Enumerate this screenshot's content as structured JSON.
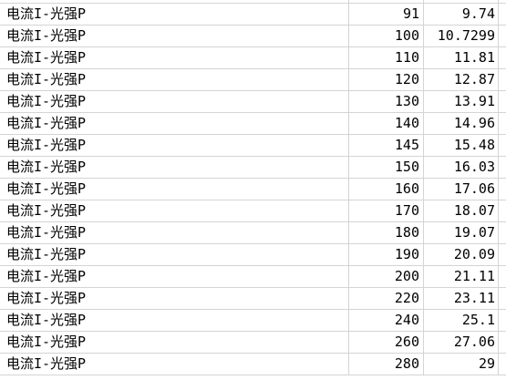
{
  "header_fragment": {
    "col_a": "……"
  },
  "rows": [
    {
      "label": "电流I-光强P",
      "p": "91",
      "i": "9.74"
    },
    {
      "label": "电流I-光强P",
      "p": "100",
      "i": "10.7299"
    },
    {
      "label": "电流I-光强P",
      "p": "110",
      "i": "11.81"
    },
    {
      "label": "电流I-光强P",
      "p": "120",
      "i": "12.87"
    },
    {
      "label": "电流I-光强P",
      "p": "130",
      "i": "13.91"
    },
    {
      "label": "电流I-光强P",
      "p": "140",
      "i": "14.96"
    },
    {
      "label": "电流I-光强P",
      "p": "145",
      "i": "15.48"
    },
    {
      "label": "电流I-光强P",
      "p": "150",
      "i": "16.03"
    },
    {
      "label": "电流I-光强P",
      "p": "160",
      "i": "17.06"
    },
    {
      "label": "电流I-光强P",
      "p": "170",
      "i": "18.07"
    },
    {
      "label": "电流I-光强P",
      "p": "180",
      "i": "19.07"
    },
    {
      "label": "电流I-光强P",
      "p": "190",
      "i": "20.09"
    },
    {
      "label": "电流I-光强P",
      "p": "200",
      "i": "21.11"
    },
    {
      "label": "电流I-光强P",
      "p": "220",
      "i": "23.11"
    },
    {
      "label": "电流I-光强P",
      "p": "240",
      "i": "25.1"
    },
    {
      "label": "电流I-光强P",
      "p": "260",
      "i": "27.06"
    },
    {
      "label": "电流I-光强P",
      "p": "280",
      "i": "29"
    }
  ]
}
